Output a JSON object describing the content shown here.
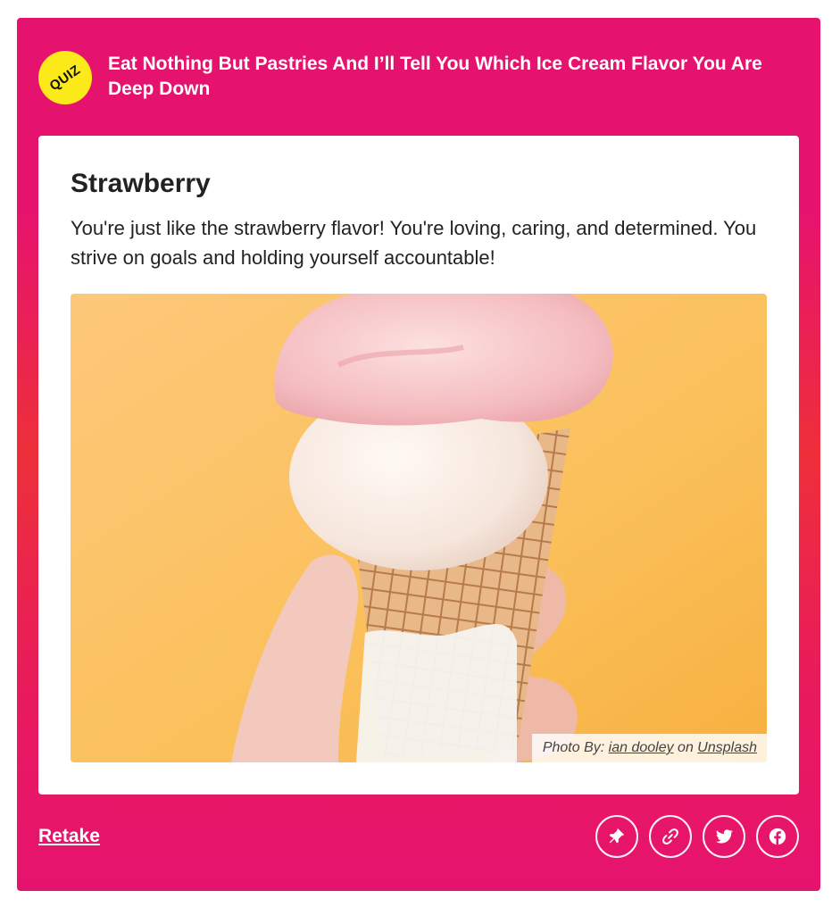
{
  "quiz": {
    "badge": "QUIZ",
    "title": "Eat Nothing But Pastries And I’ll Tell You Which Ice Cream Flavor You Are Deep Down"
  },
  "result": {
    "heading": "Strawberry",
    "description": "You're just like the strawberry flavor! You're loving, caring, and determined. You strive on goals and holding yourself accountable!",
    "image_alt": "Hand holding a waffle cone with vanilla and strawberry ice cream",
    "credit": {
      "prefix": "Photo By: ",
      "author": "ian dooley",
      "middle": " on ",
      "source": "Unsplash"
    }
  },
  "footer": {
    "retake_label": "Retake",
    "share_icons": [
      "pin-icon",
      "link-icon",
      "twitter-icon",
      "facebook-icon"
    ]
  },
  "colors": {
    "brand_pink": "#e6136e",
    "brand_red": "#ee2f3a",
    "badge_yellow": "#fbe91a"
  }
}
